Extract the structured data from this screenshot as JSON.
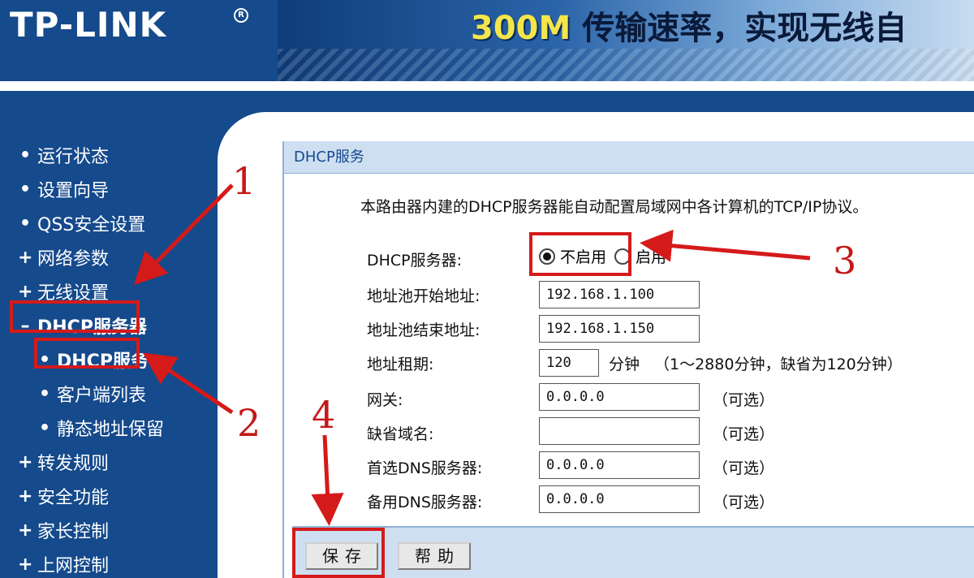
{
  "header": {
    "logo": "TP-LINK",
    "logo_mark": "R",
    "banner_highlight": "300M",
    "banner_rest": " 传输速率，实现无线自"
  },
  "sidebar": {
    "items": [
      {
        "label": "运行状态",
        "bullet": "•"
      },
      {
        "label": "设置向导",
        "bullet": "•"
      },
      {
        "label": "QSS安全设置",
        "bullet": "•"
      },
      {
        "label": "网络参数",
        "bullet": "+"
      },
      {
        "label": "无线设置",
        "bullet": "+"
      },
      {
        "label": "DHCP服务器",
        "bullet": "–"
      },
      {
        "label": "DHCP服务",
        "bullet": "•"
      },
      {
        "label": "客户端列表",
        "bullet": "•"
      },
      {
        "label": "静态地址保留",
        "bullet": "•"
      },
      {
        "label": "转发规则",
        "bullet": "+"
      },
      {
        "label": "安全功能",
        "bullet": "+"
      },
      {
        "label": "家长控制",
        "bullet": "+"
      },
      {
        "label": "上网控制",
        "bullet": "+"
      }
    ]
  },
  "panel": {
    "title": "DHCP服务",
    "description": "本路由器内建的DHCP服务器能自动配置局域网中各计算机的TCP/IP协议。"
  },
  "form": {
    "dhcp_server_label": "DHCP服务器:",
    "option_disable": "不启用",
    "option_enable": "启用",
    "start_label": "地址池开始地址:",
    "start_value": "192.168.1.100",
    "end_label": "地址池结束地址:",
    "end_value": "192.168.1.150",
    "lease_label": "地址租期:",
    "lease_value": "120",
    "lease_unit": "分钟",
    "lease_note": "（1～2880分钟，缺省为120分钟）",
    "gateway_label": "网关:",
    "gateway_value": "0.0.0.0",
    "domain_label": "缺省域名:",
    "domain_value": "",
    "dns1_label": "首选DNS服务器:",
    "dns1_value": "0.0.0.0",
    "dns2_label": "备用DNS服务器:",
    "dns2_value": "0.0.0.0",
    "optional": "（可选）"
  },
  "buttons": {
    "save": "保存",
    "help": "帮助"
  },
  "annotations": {
    "n1": "1",
    "n2": "2",
    "n3": "3",
    "n4": "4",
    "color": "#d51a1a"
  }
}
